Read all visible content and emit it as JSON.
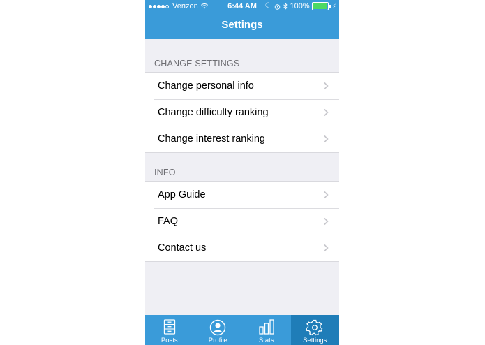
{
  "status_bar": {
    "carrier": "Verizon",
    "time": "6:44 AM",
    "battery": "100%",
    "battery_color": "#4cd964"
  },
  "nav": {
    "title": "Settings"
  },
  "sections": [
    {
      "header": "CHANGE SETTINGS",
      "items": [
        {
          "label": "Change personal info"
        },
        {
          "label": "Change difficulty ranking"
        },
        {
          "label": "Change interest ranking"
        }
      ]
    },
    {
      "header": "INFO",
      "items": [
        {
          "label": "App Guide"
        },
        {
          "label": "FAQ"
        },
        {
          "label": "Contact us"
        }
      ]
    }
  ],
  "tabbar": {
    "tabs": [
      {
        "label": "Posts",
        "icon": "posts-icon"
      },
      {
        "label": "Profile",
        "icon": "profile-icon"
      },
      {
        "label": "Stats",
        "icon": "stats-icon"
      },
      {
        "label": "Settings",
        "icon": "gear-icon",
        "active": true
      }
    ]
  },
  "colors": {
    "primary": "#3a9bd9",
    "active_tab": "#1f7db8",
    "background": "#efeff4"
  }
}
